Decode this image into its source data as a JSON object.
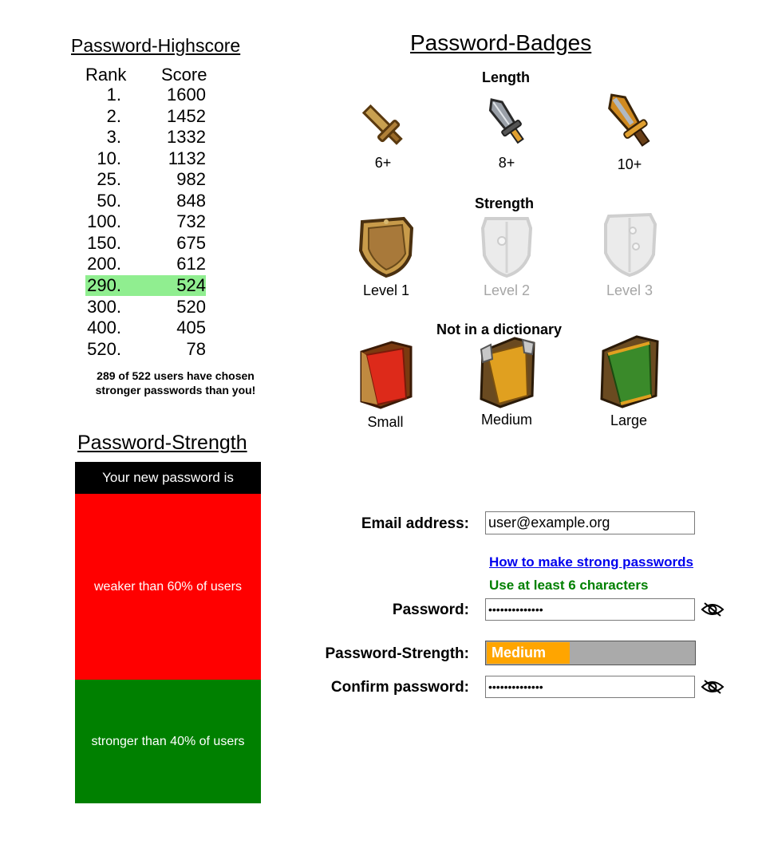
{
  "highscore": {
    "title": "Password-Highscore",
    "rank_header": "Rank",
    "score_header": "Score",
    "rows": [
      {
        "rank": "1.",
        "score": "1600"
      },
      {
        "rank": "2.",
        "score": "1452"
      },
      {
        "rank": "3.",
        "score": "1332"
      },
      {
        "rank": "10.",
        "score": "1132"
      },
      {
        "rank": "25.",
        "score": "982"
      },
      {
        "rank": "50.",
        "score": "848"
      },
      {
        "rank": "100.",
        "score": "732"
      },
      {
        "rank": "150.",
        "score": "675"
      },
      {
        "rank": "200.",
        "score": "612"
      },
      {
        "rank": "290.",
        "score": "524",
        "highlight": true
      },
      {
        "rank": "300.",
        "score": "520"
      },
      {
        "rank": "400.",
        "score": "405"
      },
      {
        "rank": "520.",
        "score": "78"
      }
    ],
    "summary_line1": "289 of 522 users have chosen",
    "summary_line2": "stronger passwords than you!",
    "highlight_color": "#90ee90"
  },
  "strength_panel": {
    "title": "Password-Strength",
    "header": "Your new password is",
    "weaker_text": "weaker than 60% of users",
    "stronger_text": "stronger than 40% of users",
    "weaker_color": "#ff0000",
    "stronger_color": "#008000"
  },
  "badges": {
    "title": "Password-Badges",
    "length": {
      "title": "Length",
      "items": [
        {
          "icon": "wooden-sword-icon",
          "label": "6+",
          "earned": true
        },
        {
          "icon": "steel-dagger-icon",
          "label": "8+",
          "earned": true
        },
        {
          "icon": "golden-sword-icon",
          "label": "10+",
          "earned": true
        }
      ]
    },
    "strength": {
      "title": "Strength",
      "items": [
        {
          "icon": "wooden-shield-icon",
          "label": "Level 1",
          "earned": true
        },
        {
          "icon": "shield-icon",
          "label": "Level 2",
          "earned": false
        },
        {
          "icon": "shield-icon",
          "label": "Level 3",
          "earned": false
        }
      ]
    },
    "dictionary": {
      "title": "Not in a dictionary",
      "items": [
        {
          "icon": "red-book-icon",
          "label": "Small",
          "earned": true
        },
        {
          "icon": "yellow-book-icon",
          "label": "Medium",
          "earned": true
        },
        {
          "icon": "green-book-icon",
          "label": "Large",
          "earned": true
        }
      ]
    }
  },
  "form": {
    "email_label": "Email address:",
    "email_value": "user@example.org",
    "help_link": "How to make strong passwords",
    "hint": "Use at least 6 characters",
    "password_label": "Password:",
    "password_value": "••••••••••••••",
    "strength_label": "Password-Strength:",
    "strength_value": "Medium",
    "strength_fraction": 0.4,
    "strength_color": "#ffa500",
    "confirm_label": "Confirm password:",
    "confirm_value": "••••••••••••••",
    "eye_icon": "eye-slash-icon"
  }
}
